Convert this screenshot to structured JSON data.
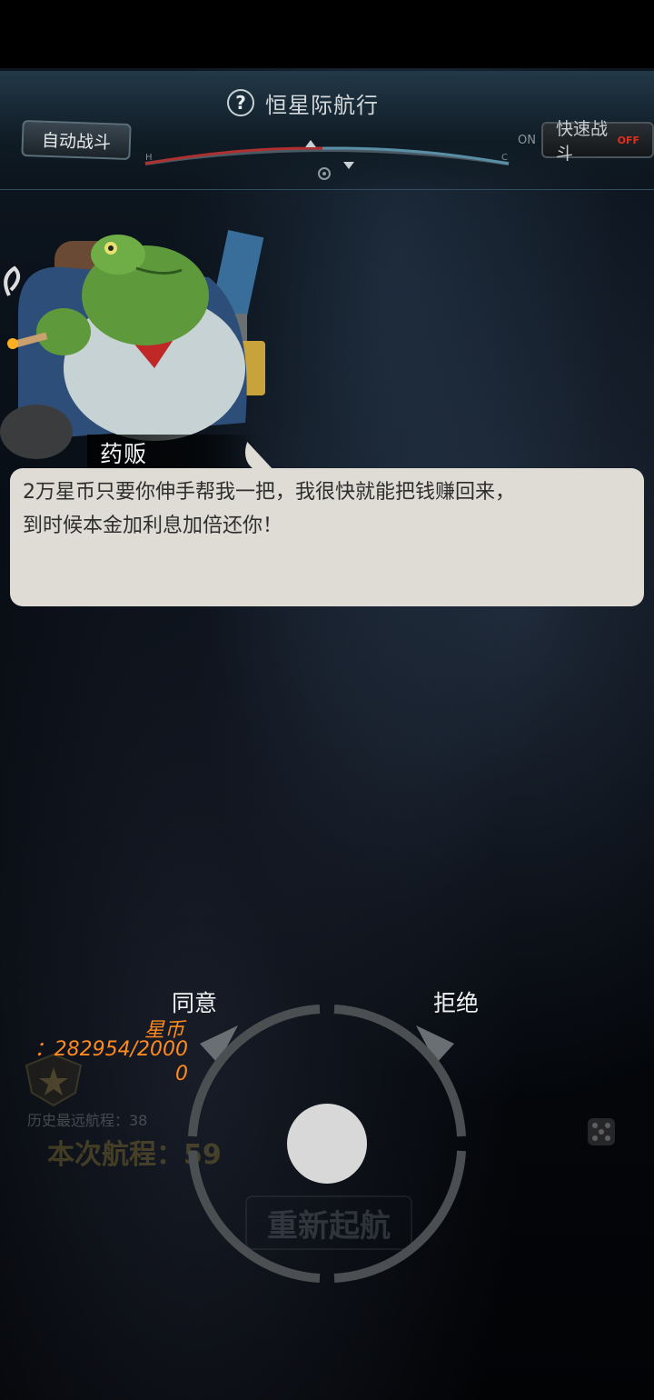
{
  "header": {
    "title": "恒星际航行",
    "help_icon": "?",
    "auto_battle": "自动战斗",
    "fast_battle": "快速战斗",
    "fast_on": "ON",
    "fast_off": "OFF",
    "gauge_left": "H",
    "gauge_right": "C"
  },
  "dialog": {
    "speaker": "药贩",
    "text": "2万星币只要你伸手帮我一把，我很快就能把钱赚回来，\n到时候本金加利息加倍还你！"
  },
  "choices": {
    "agree": "同意",
    "reject": "拒绝"
  },
  "currency": {
    "label": "星币",
    "value": "：282954/20000"
  },
  "background_hud": {
    "history_best": "历史最远航程：38",
    "current_voyage": "本次航程：59",
    "relaunch": "重新起航"
  },
  "colors": {
    "currency_orange": "#ff8a1e",
    "dialog_bg": "#dedcd5",
    "off_red": "#e03020"
  }
}
